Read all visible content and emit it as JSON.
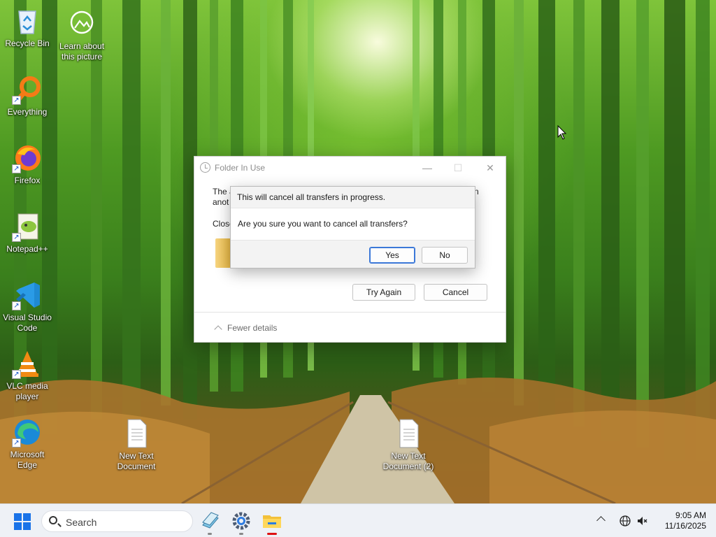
{
  "desktop": {
    "icons": [
      {
        "label": "Recycle Bin",
        "icon": "recycle-bin-icon"
      },
      {
        "label": "Learn about this picture",
        "icon": "camera-info-icon"
      },
      {
        "label": "Everything",
        "icon": "everything-search-icon"
      },
      {
        "label": "Firefox",
        "icon": "firefox-icon"
      },
      {
        "label": "Notepad++",
        "icon": "notepad-plus-plus-icon"
      },
      {
        "label": "Visual Studio Code",
        "icon": "vscode-icon"
      },
      {
        "label": "VLC media player",
        "icon": "vlc-icon"
      },
      {
        "label": "Microsoft Edge",
        "icon": "edge-icon"
      },
      {
        "label": "New Text Document",
        "icon": "text-document-icon"
      },
      {
        "label": "New Text Document (2)",
        "icon": "text-document-icon"
      }
    ]
  },
  "folder_in_use": {
    "title": "Folder In Use",
    "text_line1": "The a",
    "text_line1_right": "n",
    "text_line2": "anot",
    "text_line3": "Close",
    "try_again_label": "Try Again",
    "cancel_label": "Cancel",
    "fewer_details_label": "Fewer details",
    "minimize_glyph": "—",
    "maximize_glyph": "☐",
    "close_glyph": "✕"
  },
  "confirm_dialog": {
    "heading": "This will cancel all transfers in progress.",
    "question": "Are you sure you want to cancel all transfers?",
    "yes_label": "Yes",
    "no_label": "No"
  },
  "taskbar": {
    "search_label": "Search",
    "time": "9:05 AM",
    "date": "11/16/2025",
    "apps": [
      "stacked-files-icon",
      "settings-gear-icon",
      "file-explorer-icon"
    ]
  },
  "colors": {
    "accent": "#1a73e8",
    "primary_button_border": "#3b78d8",
    "active_app_indicator": "#dd1111"
  }
}
